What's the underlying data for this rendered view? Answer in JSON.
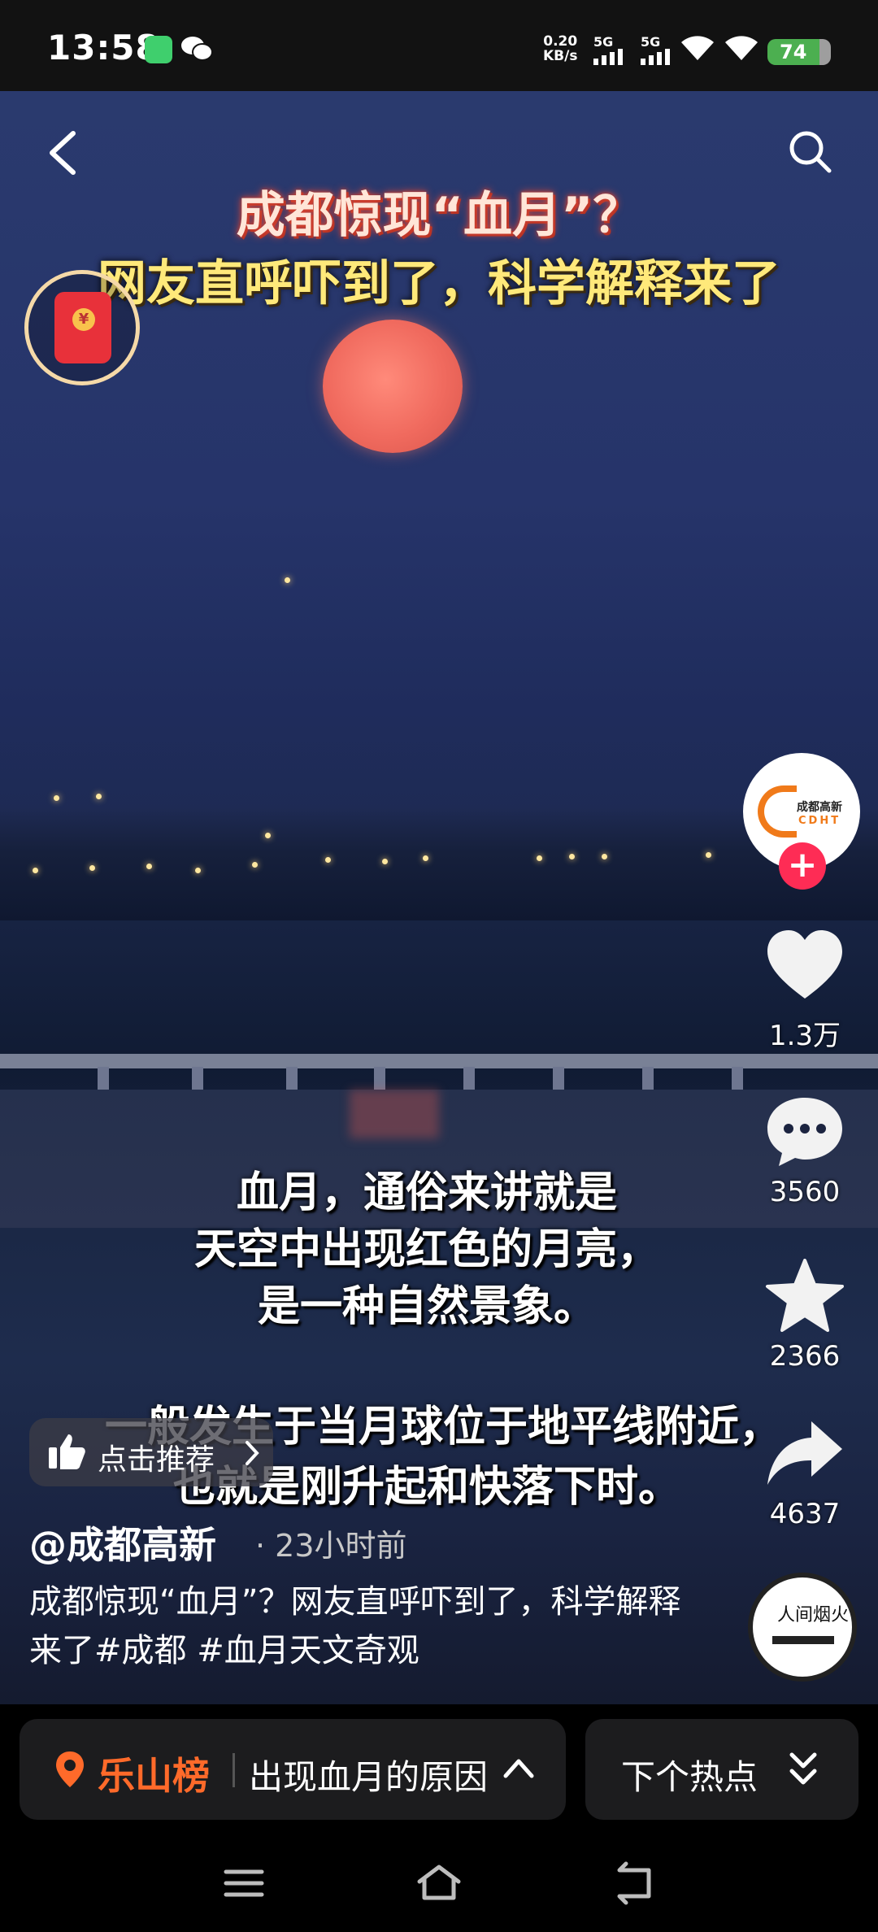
{
  "status_bar": {
    "time": "13:58",
    "net_speed_value": "0.20",
    "net_speed_unit": "KB/s",
    "signal1_label": "5G",
    "signal2_label": "5G",
    "battery": "74"
  },
  "video": {
    "title_line1": "成都惊现“血月”？",
    "title_line2": "网友直呼吓到了，科学解释来了",
    "subtitle_line1": "血月，通俗来讲就是",
    "subtitle_line2": "天空中出现红色的月亮，",
    "subtitle_line3": "是一种自然景象。",
    "subtitle_line4": "一般发生于当月球位于地平线附近，",
    "subtitle_line5": "也就是刚升起和快落下时。"
  },
  "profile": {
    "avatar_text_cn": "成都高新",
    "avatar_text_en": "CDHT",
    "follow_symbol": "+"
  },
  "actions": {
    "likes": "1.3万",
    "comments": "3560",
    "favorites": "2366",
    "shares": "4637"
  },
  "recommend": {
    "label": "点击推荐"
  },
  "post": {
    "author": "@成都高新",
    "time_ago": "· 23小时前",
    "caption": "成都惊现“血月”？网友直呼吓到了，科学解释来了#成都 #血月天文奇观"
  },
  "music": {
    "text": "人间烟火"
  },
  "hot_bar": {
    "brand": "乐山榜",
    "topic": "出现血月的原因",
    "next_label": "下个热点"
  },
  "colors": {
    "brand_orange": "#ff6a2a",
    "follow_red": "#fe2c55",
    "moon": "#f06a5e"
  }
}
